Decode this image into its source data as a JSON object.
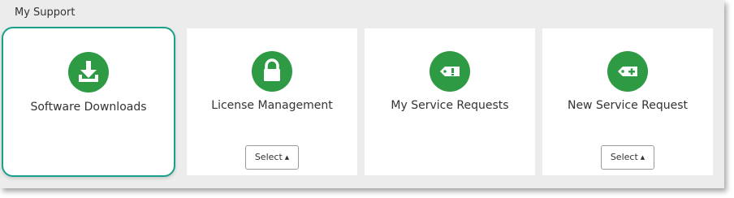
{
  "panel": {
    "title": "My Support"
  },
  "cards": [
    {
      "label": "Software Downloads",
      "icon": "download-icon",
      "selected": true,
      "select_button": null
    },
    {
      "label": "License Management",
      "icon": "lock-icon",
      "selected": false,
      "select_button": "Select"
    },
    {
      "label": "My Service Requests",
      "icon": "ticket-exclamation-icon",
      "selected": false,
      "select_button": null
    },
    {
      "label": "New Service Request",
      "icon": "ticket-plus-icon",
      "selected": false,
      "select_button": "Select"
    }
  ],
  "colors": {
    "panel_bg": "#ececec",
    "card_bg": "#ffffff",
    "icon_green": "#2e9a44",
    "selected_border": "#1a9f8a",
    "text": "#333333"
  }
}
